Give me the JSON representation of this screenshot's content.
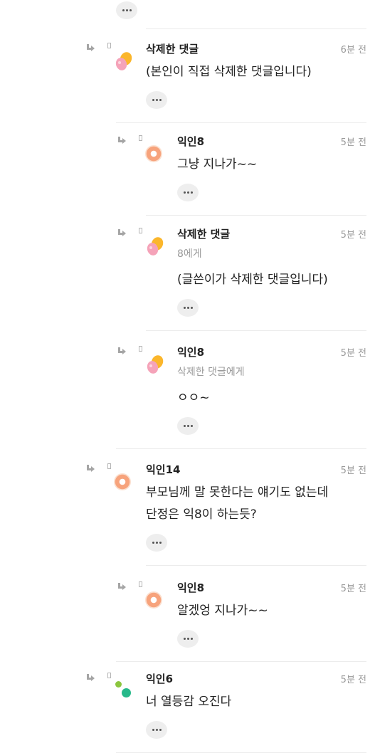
{
  "more_icon": "more-horizontal-icon",
  "comments": [
    {
      "name": "삭제한 댓글",
      "time": "6분 전",
      "to": "",
      "text": "(본인이 직접 삭제한 댓글입니다)",
      "avatar": "eggs"
    },
    {
      "name": "익인8",
      "time": "5분 전",
      "to": "",
      "text": "그냥 지나가~~",
      "avatar": "ring"
    },
    {
      "name": "삭제한 댓글",
      "time": "5분 전",
      "to": "8에게",
      "text": "(글쓴이가 삭제한 댓글입니다)",
      "avatar": "eggs"
    },
    {
      "name": "익인8",
      "time": "5분 전",
      "to": "삭제한 댓글에게",
      "text": "ㅇㅇ~",
      "avatar": "eggs"
    },
    {
      "name": "익인14",
      "time": "5분 전",
      "to": "",
      "text": "부모님께 말 못한다는 얘기도 없는데\n단정은 익8이 하는듯?",
      "avatar": "ring"
    },
    {
      "name": "익인8",
      "time": "5분 전",
      "to": "",
      "text": "알겠엉 지나가~~",
      "avatar": "ring"
    },
    {
      "name": "익인6",
      "time": "5분 전",
      "to": "",
      "text": "너 열등감 오진다",
      "avatar": "dots"
    }
  ]
}
